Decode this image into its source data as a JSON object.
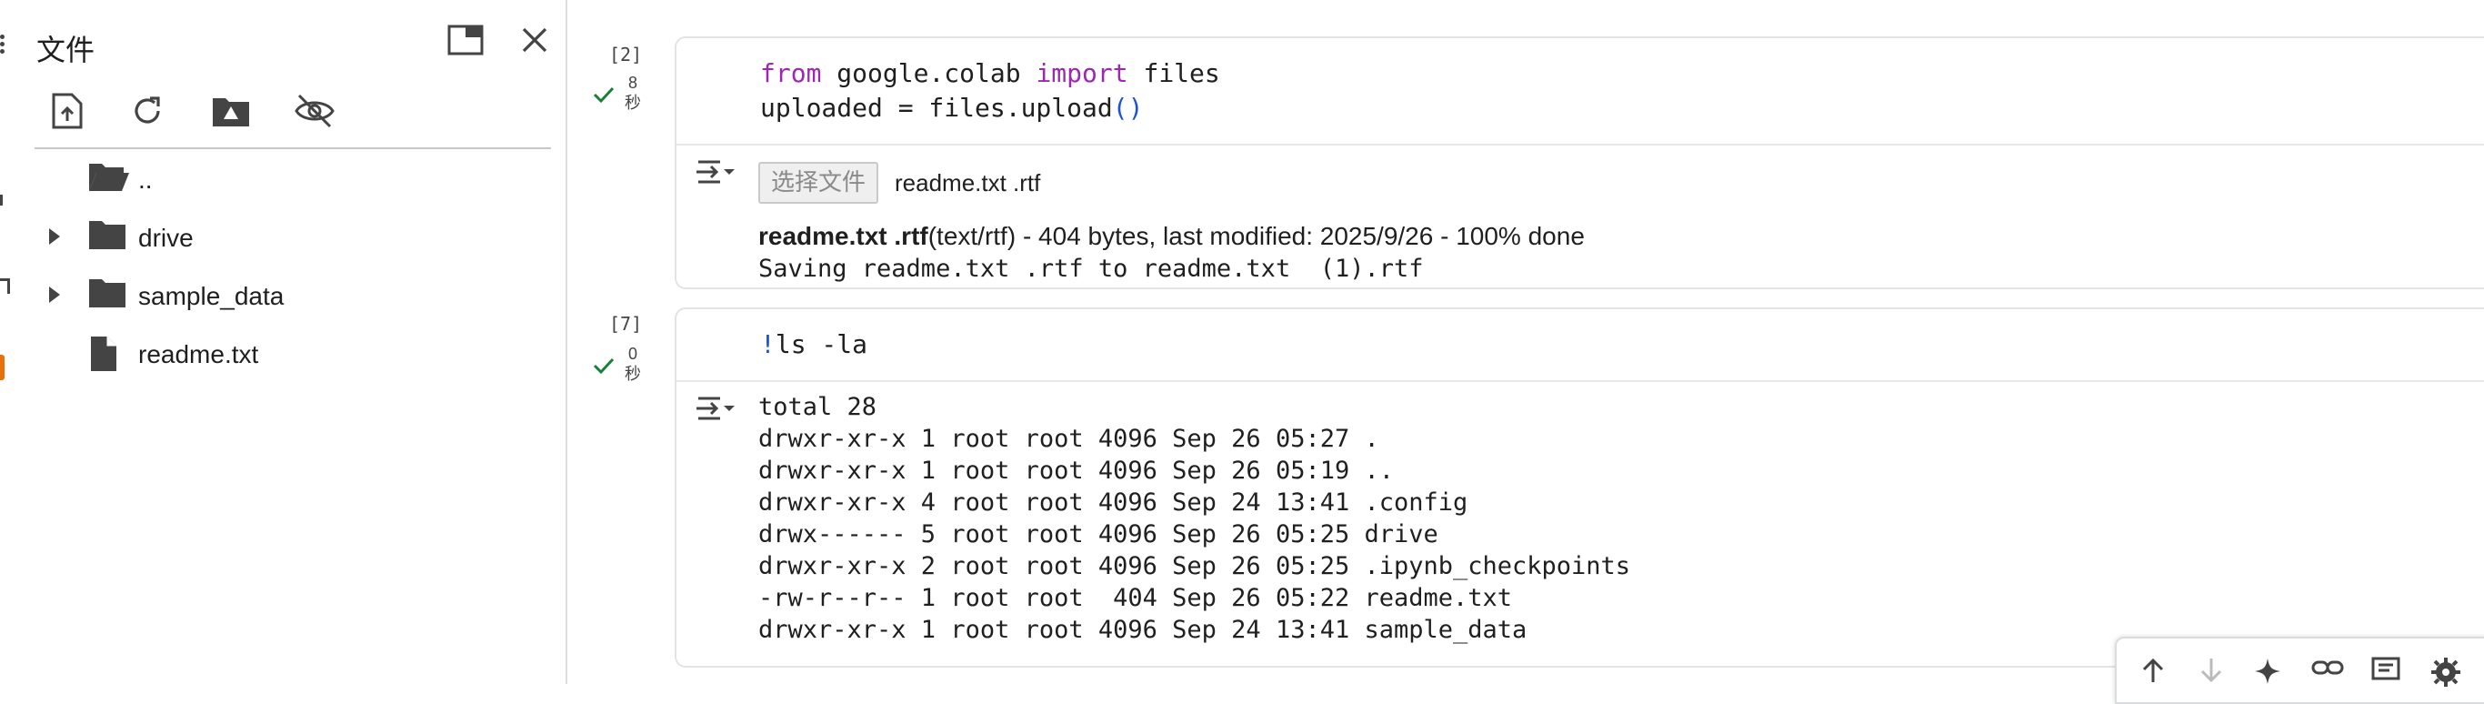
{
  "panel": {
    "title": "文件",
    "tree": [
      {
        "label": "..",
        "kind": "parent-folder",
        "expandable": false
      },
      {
        "label": "drive",
        "kind": "folder",
        "expandable": true
      },
      {
        "label": "sample_data",
        "kind": "folder",
        "expandable": true
      },
      {
        "label": "readme.txt",
        "kind": "file",
        "expandable": false
      }
    ],
    "tools": [
      "upload-icon",
      "refresh-icon",
      "mount-drive-icon",
      "hide-files-icon"
    ],
    "header_buttons": [
      "window-icon",
      "close-icon"
    ]
  },
  "cells": [
    {
      "exec_count": "[2]",
      "exec_time_value": "8",
      "exec_time_unit": "秒",
      "status": "success",
      "code": {
        "line1": {
          "kw1": "from",
          "mod": " google.colab ",
          "kw2": "import",
          "rest": " files"
        },
        "line2": {
          "text": "uploaded = files.upload",
          "paren": "()"
        }
      },
      "output": {
        "file_button": "选择文件",
        "file_names": "readme.txt .rtf",
        "upload_name": "readme.txt .rtf",
        "upload_info": "(text/rtf) - 404 bytes, last modified: 2025/9/26 - 100% done",
        "saving": "Saving readme.txt .rtf to readme.txt  (1).rtf"
      }
    },
    {
      "exec_count": "[7]",
      "exec_time_value": "0",
      "exec_time_unit": "秒",
      "status": "success",
      "code": {
        "bang": "!",
        "cmd": "ls -la"
      },
      "output": {
        "lines": [
          "total 28",
          "drwxr-xr-x 1 root root 4096 Sep 26 05:27 .",
          "drwxr-xr-x 1 root root 4096 Sep 26 05:19 ..",
          "drwxr-xr-x 4 root root 4096 Sep 24 13:41 .config",
          "drwx------ 5 root root 4096 Sep 26 05:25 drive",
          "drwxr-xr-x 2 root root 4096 Sep 26 05:25 .ipynb_checkpoints",
          "-rw-r--r-- 1 root root  404 Sep 26 05:22 readme.txt",
          "drwxr-xr-x 1 root root 4096 Sep 24 13:41 sample_data"
        ]
      }
    }
  ],
  "toolbar": [
    "move-up-icon",
    "move-down-icon",
    "sparkle-icon",
    "link-icon",
    "comment-icon",
    "settings-icon"
  ],
  "colors": {
    "accent": "#e8710a",
    "keyword": "#9c27b0",
    "paren": "#1a53d6",
    "check": "#188038"
  }
}
